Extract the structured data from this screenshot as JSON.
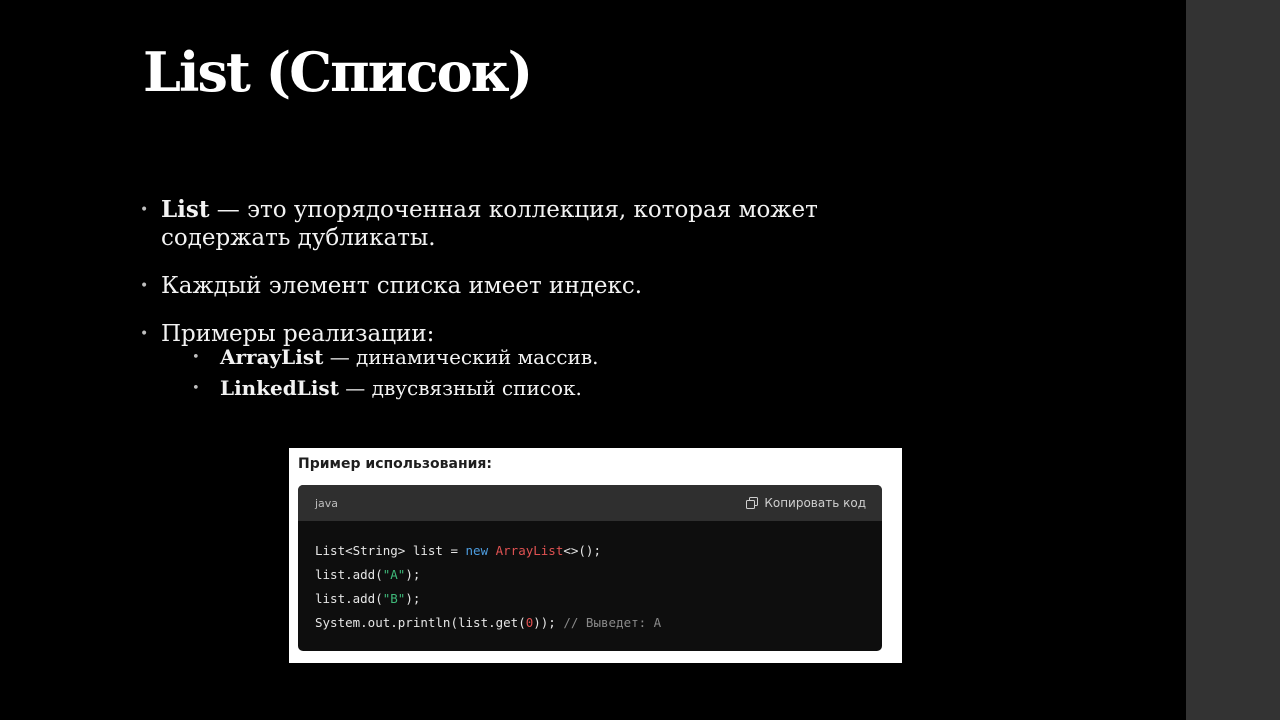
{
  "slide": {
    "title": "List (Список)",
    "bullets": [
      {
        "strong": "List",
        "text": " — это упорядоченная коллекция, которая может содержать дубликаты."
      },
      {
        "text": "Каждый элемент списка имеет индекс."
      },
      {
        "text": "Примеры реализации:"
      }
    ],
    "sub_bullets": [
      {
        "strong": "ArrayList",
        "text": " — динамический массив."
      },
      {
        "strong": "LinkedList",
        "text": " — двусвязный список."
      }
    ]
  },
  "code_example": {
    "caption": "Пример использования:",
    "language": "java",
    "copy_label": "Копировать код",
    "lines": [
      {
        "a": "List<String> list = ",
        "kw": "new",
        "sp": " ",
        "type": "ArrayList",
        "b": "<>();"
      },
      {
        "a": "list.add(",
        "str": "\"A\"",
        "b": ");"
      },
      {
        "a": "list.add(",
        "str": "\"B\"",
        "b": ");"
      },
      {
        "a": "System.out.println(list.get(",
        "num": "0",
        "b": ")); ",
        "cm": "// Выведет: A"
      }
    ]
  },
  "colors": {
    "background": "#000000",
    "side_strip": "#333333",
    "keyword": "#4d9de0",
    "type": "#e05252",
    "string": "#3fb97a",
    "comment": "#8a8a8a"
  }
}
